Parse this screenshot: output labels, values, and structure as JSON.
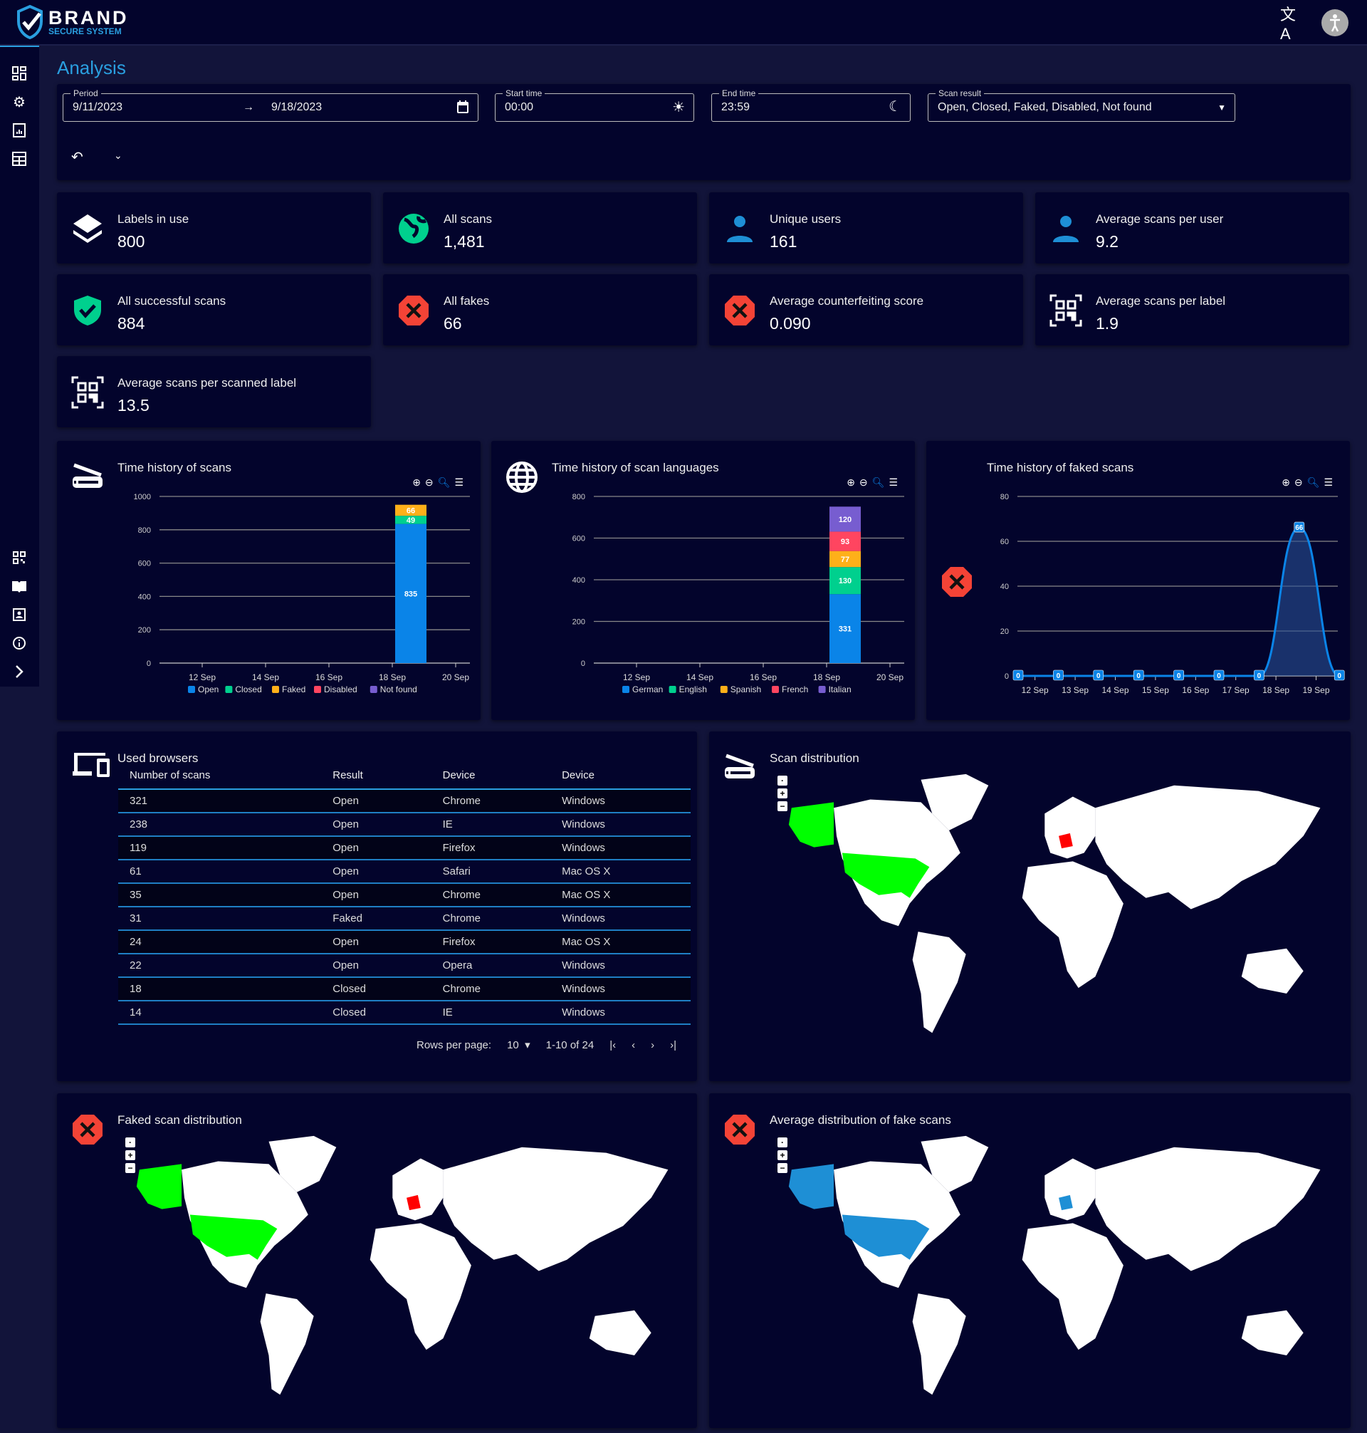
{
  "header": {
    "brand": "BRAND",
    "brand_sub": "SECURE SYSTEM",
    "icons": [
      "translate-icon",
      "accessibility-avatar-icon"
    ]
  },
  "sidebar": {
    "items": [
      "dashboard-icon",
      "settings-icon",
      "report-icon",
      "table-icon",
      "qr-code-icon",
      "book-icon",
      "contacts-icon",
      "info-icon",
      "expand-chevron-icon"
    ]
  },
  "page": {
    "title": "Analysis"
  },
  "filters": {
    "period": {
      "label": "Period",
      "start": "9/11/2023",
      "end": "9/18/2023",
      "arrow": "→"
    },
    "start_time": {
      "label": "Start time",
      "value": "00:00"
    },
    "end_time": {
      "label": "End time",
      "value": "23:59"
    },
    "scan_result": {
      "label": "Scan result",
      "value": "Open, Closed, Faked, Disabled, Not found"
    }
  },
  "stats": [
    {
      "label": "Labels in use",
      "value": "800",
      "icon": "layers-icon"
    },
    {
      "label": "All scans",
      "value": "1,481",
      "icon": "globe-icon"
    },
    {
      "label": "Unique users",
      "value": "161",
      "icon": "user-icon"
    },
    {
      "label": "Average scans per user",
      "value": "9.2",
      "icon": "user-icon"
    },
    {
      "label": "All successful scans",
      "value": "884",
      "icon": "shield-check-icon"
    },
    {
      "label": "All fakes",
      "value": "66",
      "icon": "error-octagon-icon"
    },
    {
      "label": "Average counterfeiting score",
      "value": "0.090",
      "icon": "error-octagon-icon"
    },
    {
      "label": "Average scans per label",
      "value": "1.9",
      "icon": "qr-code-icon"
    },
    {
      "label": "Average scans per scanned label",
      "value": "13.5",
      "icon": "qr-code-icon"
    }
  ],
  "colors": {
    "accent": "#2a9fe0",
    "open": "#0a84e8",
    "closed": "#00d08e",
    "faked": "#feb019",
    "disabled": "#ff4560",
    "not_found": "#775dd0",
    "error": "#f44336",
    "map_highlight": "#00ff00",
    "map_fake": "#ff0000",
    "map_avg": "#1e8fd5"
  },
  "chart_data": [
    {
      "type": "bar",
      "title": "Time history of scans",
      "stacked": true,
      "ylim": [
        0,
        1000
      ],
      "yticks": [
        0,
        200,
        400,
        600,
        800,
        1000
      ],
      "xticks": [
        "12 Sep",
        "14 Sep",
        "16 Sep",
        "18 Sep",
        "20 Sep"
      ],
      "categories": [
        "18 Sep"
      ],
      "series": [
        {
          "name": "Open",
          "values": [
            835
          ],
          "color": "#0a84e8"
        },
        {
          "name": "Closed",
          "values": [
            49
          ],
          "color": "#00d08e"
        },
        {
          "name": "Faked",
          "values": [
            66
          ],
          "color": "#feb019"
        },
        {
          "name": "Disabled",
          "values": [
            0
          ],
          "color": "#ff4560"
        },
        {
          "name": "Not found",
          "values": [
            0
          ],
          "color": "#775dd0"
        }
      ],
      "legend": "bottom"
    },
    {
      "type": "bar",
      "title": "Time history of scan languages",
      "stacked": true,
      "ylim": [
        0,
        800
      ],
      "yticks": [
        0,
        200,
        400,
        600,
        800
      ],
      "xticks": [
        "12 Sep",
        "14 Sep",
        "16 Sep",
        "18 Sep",
        "20 Sep"
      ],
      "categories": [
        "18 Sep"
      ],
      "series": [
        {
          "name": "German",
          "values": [
            331
          ],
          "color": "#0a84e8"
        },
        {
          "name": "English",
          "values": [
            130
          ],
          "color": "#00d08e"
        },
        {
          "name": "Spanish",
          "values": [
            77
          ],
          "color": "#feb019"
        },
        {
          "name": "French",
          "values": [
            93
          ],
          "color": "#ff4560"
        },
        {
          "name": "Italian",
          "values": [
            120
          ],
          "color": "#775dd0"
        }
      ],
      "legend": "bottom"
    },
    {
      "type": "area",
      "title": "Time history of faked scans",
      "ylim": [
        0,
        80
      ],
      "yticks": [
        0,
        20,
        40,
        60,
        80
      ],
      "xticks": [
        "12 Sep",
        "13 Sep",
        "14 Sep",
        "15 Sep",
        "16 Sep",
        "17 Sep",
        "18 Sep",
        "19 Sep"
      ],
      "x": [
        "11 Sep",
        "12 Sep",
        "13 Sep",
        "14 Sep",
        "15 Sep",
        "16 Sep",
        "17 Sep",
        "18 Sep",
        "19 Sep"
      ],
      "values": [
        0,
        0,
        0,
        0,
        0,
        0,
        0,
        66,
        0
      ],
      "color": "#0a84e8"
    }
  ],
  "chart_tools": [
    "zoom-in-icon",
    "zoom-out-icon",
    "zoom-select-icon",
    "menu-icon"
  ],
  "browsers": {
    "title": "Used browsers",
    "columns": [
      "Number of scans",
      "Result",
      "Device",
      "Device"
    ],
    "rows": [
      [
        "321",
        "Open",
        "Chrome",
        "Windows"
      ],
      [
        "238",
        "Open",
        "IE",
        "Windows"
      ],
      [
        "119",
        "Open",
        "Firefox",
        "Windows"
      ],
      [
        "61",
        "Open",
        "Safari",
        "Mac OS X"
      ],
      [
        "35",
        "Open",
        "Chrome",
        "Mac OS X"
      ],
      [
        "31",
        "Faked",
        "Chrome",
        "Windows"
      ],
      [
        "24",
        "Open",
        "Firefox",
        "Mac OS X"
      ],
      [
        "22",
        "Open",
        "Opera",
        "Windows"
      ],
      [
        "18",
        "Closed",
        "Chrome",
        "Windows"
      ],
      [
        "14",
        "Closed",
        "IE",
        "Windows"
      ]
    ],
    "rows_per_page_label": "Rows per page:",
    "rows_per_page": "10",
    "range": "1-10 of 24"
  },
  "maps": [
    {
      "title": "Scan distribution",
      "usa": "#00ff00",
      "germany": "#ff0000"
    },
    {
      "title": "Faked scan distribution",
      "usa": "#00ff00",
      "germany": "#ff0000"
    },
    {
      "title": "Average distribution of fake scans",
      "usa": "#1e8fd5",
      "germany": "#1e8fd5"
    }
  ]
}
